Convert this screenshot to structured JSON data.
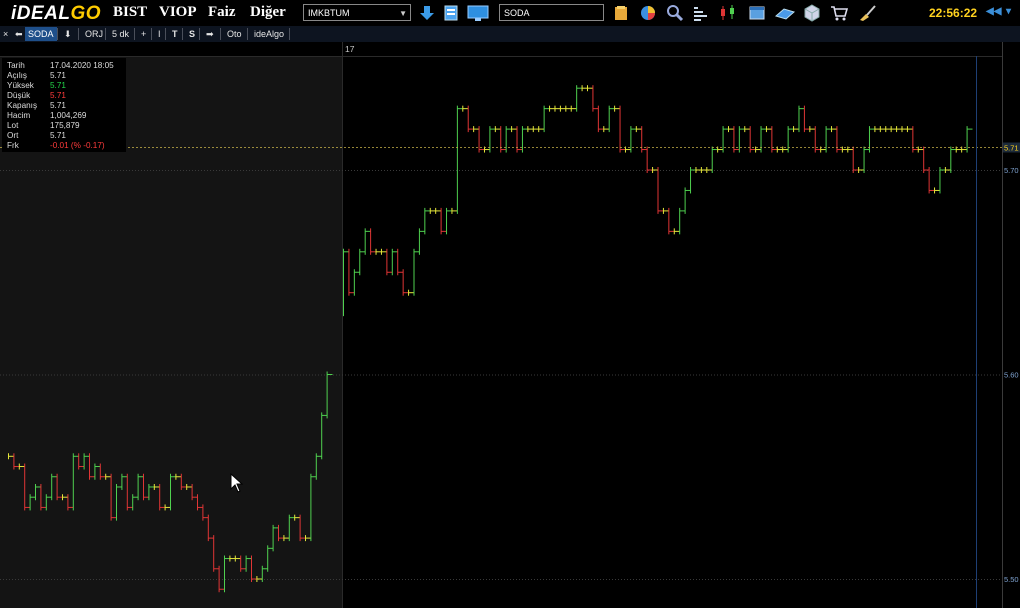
{
  "app": {
    "logo_main": "iDEAL",
    "logo_accent": "GO",
    "clock": "22:56:22"
  },
  "menu": [
    {
      "label": "BIST"
    },
    {
      "label": "VIOP"
    },
    {
      "label": "Faiz"
    },
    {
      "label": "Diğer"
    }
  ],
  "market_select": {
    "value": "IMKBTUM"
  },
  "symbol_input": {
    "value": "SODA"
  },
  "toolbar_icons": [
    "arrow-down-icon",
    "document-icon",
    "monitor-icon",
    "folder-icon",
    "pie-chart-icon",
    "search-icon",
    "bars-list-icon",
    "candlestick-icon",
    "window-icon",
    "network-icon",
    "cube-icon",
    "cart-icon",
    "brush-icon"
  ],
  "toolbar2": {
    "close": "×",
    "back": "⬅",
    "symbol": "SODA",
    "down": "⬇",
    "orj": "ORJ",
    "period": "5 dk",
    "plus": "+",
    "line": "I",
    "t": "T",
    "s": "S",
    "arrow": "➡",
    "oto": "Oto",
    "idealgo": "ideAlgo"
  },
  "info_panel": {
    "rows": [
      {
        "label": "Tarih",
        "value": "17.04.2020 18:05",
        "color": "#dddddd"
      },
      {
        "label": "Açılış",
        "value": "5.71",
        "color": "#dddddd"
      },
      {
        "label": "Yüksek",
        "value": "5.71",
        "color": "#22d64a"
      },
      {
        "label": "Düşük",
        "value": "5.71",
        "color": "#ff3b3b"
      },
      {
        "label": "Kapanış",
        "value": "5.71",
        "color": "#dddddd"
      },
      {
        "label": "Hacim",
        "value": "1,004,269",
        "color": "#dddddd"
      },
      {
        "label": "Lot",
        "value": "175,879",
        "color": "#dddddd"
      },
      {
        "label": "Ort",
        "value": "5.71",
        "color": "#dddddd"
      },
      {
        "label": "Frk",
        "value": "-0.01 (% -0.17)",
        "color": "#ff3b3b"
      }
    ]
  },
  "chart_data": {
    "type": "line",
    "subtype": "step-ohlc",
    "x_label_top": "17",
    "ylim": [
      5.49,
      5.73
    ],
    "y_ticks": [
      "5.70",
      "5.60",
      "5.50"
    ],
    "current_price_label": "5.71",
    "current_price": 5.711,
    "colors": {
      "up": "#4fd04f",
      "down": "#e03535",
      "flat": "#e4e63a",
      "grid": "#3a3a3a",
      "price_line": "#c8b24a",
      "axis_text": "#7ea2d0",
      "cursor_line": "#1e3f75"
    },
    "session1_closes": [
      5.56,
      5.555,
      5.555,
      5.535,
      5.54,
      5.545,
      5.535,
      5.54,
      5.55,
      5.54,
      5.54,
      5.535,
      5.56,
      5.555,
      5.56,
      5.55,
      5.555,
      5.55,
      5.55,
      5.53,
      5.545,
      5.55,
      5.535,
      5.54,
      5.55,
      5.54,
      5.545,
      5.545,
      5.535,
      5.535,
      5.55,
      5.55,
      5.545,
      5.545,
      5.54,
      5.535,
      5.53,
      5.52,
      5.505,
      5.495,
      5.51,
      5.51,
      5.51,
      5.505,
      5.51,
      5.5,
      5.5,
      5.505,
      5.515,
      5.525,
      5.52,
      5.52,
      5.53,
      5.53,
      5.52,
      5.52,
      5.55,
      5.56,
      5.58,
      5.6
    ],
    "session2_closes": [
      5.66,
      5.64,
      5.65,
      5.66,
      5.67,
      5.66,
      5.66,
      5.66,
      5.65,
      5.66,
      5.65,
      5.64,
      5.64,
      5.66,
      5.67,
      5.68,
      5.68,
      5.68,
      5.67,
      5.68,
      5.68,
      5.73,
      5.73,
      5.72,
      5.72,
      5.71,
      5.71,
      5.72,
      5.72,
      5.71,
      5.72,
      5.72,
      5.71,
      5.72,
      5.72,
      5.72,
      5.72,
      5.73,
      5.73,
      5.73,
      5.73,
      5.73,
      5.73,
      5.74,
      5.74,
      5.74,
      5.73,
      5.72,
      5.72,
      5.73,
      5.73,
      5.71,
      5.71,
      5.72,
      5.72,
      5.71,
      5.7,
      5.7,
      5.68,
      5.68,
      5.67,
      5.67,
      5.68,
      5.69,
      5.7,
      5.7,
      5.7,
      5.7,
      5.71,
      5.71,
      5.72,
      5.72,
      5.71,
      5.72,
      5.72,
      5.71,
      5.71,
      5.72,
      5.72,
      5.71,
      5.71,
      5.71,
      5.72,
      5.72,
      5.73,
      5.72,
      5.72,
      5.71,
      5.71,
      5.72,
      5.72,
      5.71,
      5.71,
      5.71,
      5.7,
      5.7,
      5.71,
      5.72,
      5.72,
      5.72,
      5.72,
      5.72,
      5.72,
      5.72,
      5.72,
      5.71,
      5.71,
      5.7,
      5.69,
      5.69,
      5.7,
      5.7,
      5.71,
      5.71,
      5.71,
      5.72
    ]
  }
}
